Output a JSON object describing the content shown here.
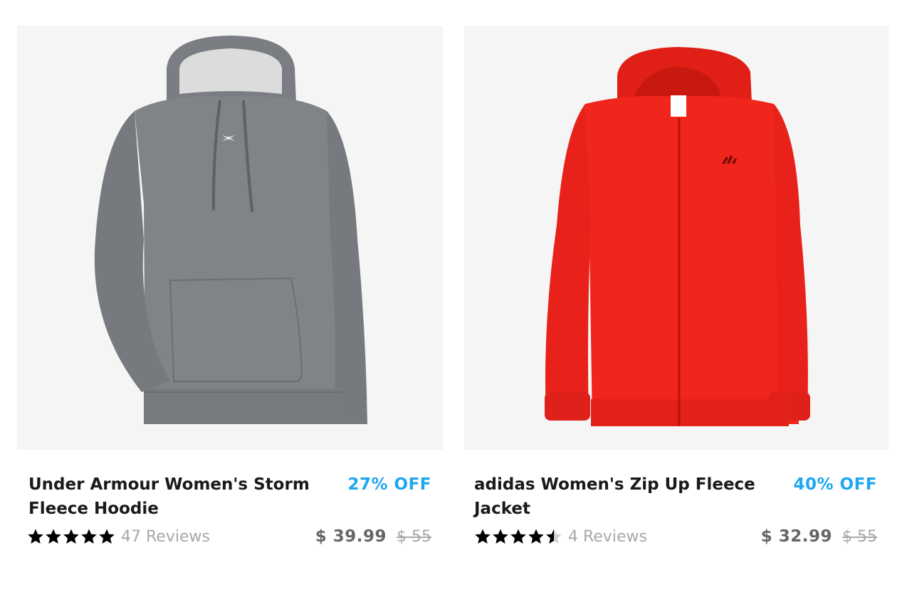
{
  "products": [
    {
      "title": "Under Armour Women's Storm Fleece Hoodie",
      "discount": "27% OFF",
      "rating": 5,
      "reviews": "47 Reviews",
      "price": "$ 39.99",
      "original_price": "$ 55",
      "image_color": "#808387"
    },
    {
      "title": "adidas Women's Zip Up Fleece Jacket",
      "discount": "40% OFF",
      "rating": 4.5,
      "reviews": "4 Reviews",
      "price": "$ 32.99",
      "original_price": "$ 55",
      "image_color": "#f0261c"
    }
  ],
  "colors": {
    "discount": "#1ea7f0",
    "star": "#000000",
    "muted": "#a8a8a8"
  }
}
